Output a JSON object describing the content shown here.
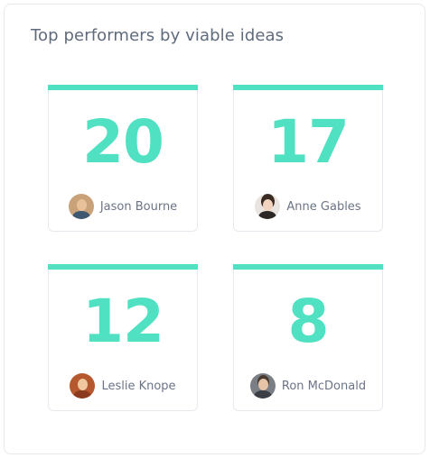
{
  "widget": {
    "title": "Top performers by viable ideas"
  },
  "colors": {
    "accent": "#4fe1c1",
    "title_text": "#5f6b7c",
    "name_text": "#6b7486"
  },
  "performers": [
    {
      "count": "20",
      "name": "Jason Bourne",
      "avatar": "person-avatar"
    },
    {
      "count": "17",
      "name": "Anne Gables",
      "avatar": "person-avatar"
    },
    {
      "count": "12",
      "name": "Leslie Knope",
      "avatar": "person-avatar"
    },
    {
      "count": "8",
      "name": "Ron McDonald",
      "avatar": "person-avatar"
    }
  ]
}
